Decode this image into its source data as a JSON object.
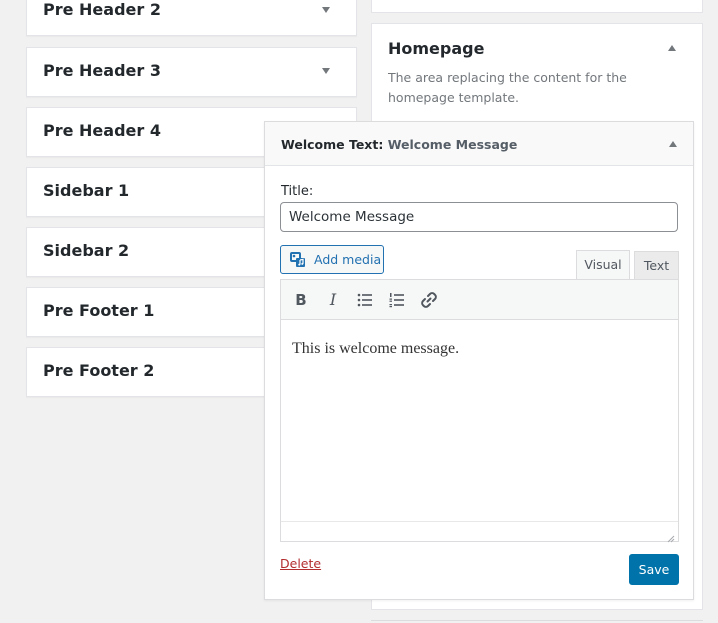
{
  "sidebar_areas": [
    {
      "label": "Pre Header 2",
      "expanded": false
    },
    {
      "label": "Pre Header 3",
      "expanded": false
    },
    {
      "label": "Pre Header 4",
      "expanded": false
    },
    {
      "label": "Sidebar 1",
      "expanded": false
    },
    {
      "label": "Sidebar 2",
      "expanded": false
    },
    {
      "label": "Pre Footer 1",
      "expanded": false
    },
    {
      "label": "Pre Footer 2",
      "expanded": false
    }
  ],
  "homepage_area": {
    "title": "Homepage",
    "description": "The area replacing the content for the homepage template.",
    "expanded": true
  },
  "widget": {
    "type_label": "Welcome Text:",
    "instance_title": "Welcome Message",
    "title_field_label": "Title:",
    "title_value": "Welcome Message",
    "add_media_label": "Add media",
    "tabs": {
      "visual": "Visual",
      "text": "Text",
      "active": "Visual"
    },
    "toolbar_icons": [
      "bold-icon",
      "italic-icon",
      "bulleted-list-icon",
      "numbered-list-icon",
      "link-icon"
    ],
    "toolbar_glyphs": {
      "bold": "B",
      "italic": "I"
    },
    "content": "This is welcome message.",
    "delete_label": "Delete",
    "save_label": "Save"
  },
  "colors": {
    "accent": "#0073aa",
    "delete": "#b32d2e",
    "background": "#f1f1f1"
  }
}
